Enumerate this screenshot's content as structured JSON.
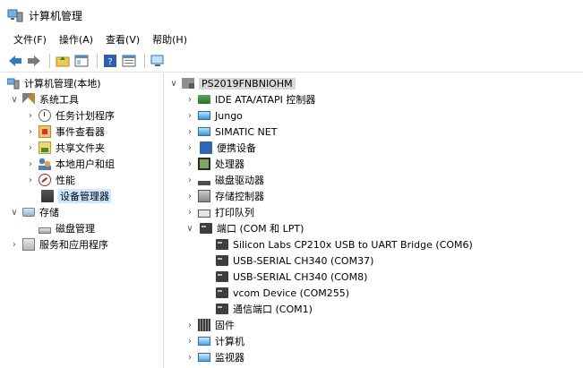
{
  "window": {
    "title": "计算机管理",
    "app_icon": "computer-management-icon"
  },
  "menu": [
    {
      "label": "文件(F)"
    },
    {
      "label": "操作(A)"
    },
    {
      "label": "查看(V)"
    },
    {
      "label": "帮助(H)"
    }
  ],
  "toolbar": {
    "buttons": [
      "back-icon",
      "forward-icon",
      "up-folder-icon",
      "show-hide-tree-icon",
      "help-icon",
      "properties-icon",
      "scan-hardware-icon"
    ]
  },
  "left_tree": {
    "root": "计算机管理(本地)",
    "system_tools": "系统工具",
    "task_scheduler": "任务计划程序",
    "event_viewer": "事件查看器",
    "shared_folders": "共享文件夹",
    "local_users": "本地用户和组",
    "performance": "性能",
    "device_manager": "设备管理器",
    "storage": "存储",
    "disk_management": "磁盘管理",
    "services_apps": "服务和应用程序"
  },
  "right_tree": {
    "computer_name": "PS2019FNBNIOHM",
    "categories": {
      "ide": "IDE ATA/ATAPI 控制器",
      "jungo": "Jungo",
      "simatic": "SIMATIC NET",
      "portable": "便携设备",
      "processor": "处理器",
      "disk_drives": "磁盘驱动器",
      "storage_ctl": "存储控制器",
      "print_queue": "打印队列",
      "ports": "端口 (COM 和 LPT)",
      "firmware": "固件",
      "computer": "计算机",
      "monitor": "监视器"
    },
    "ports": [
      "Silicon Labs CP210x USB to UART Bridge (COM6)",
      "USB-SERIAL CH340 (COM37)",
      "USB-SERIAL CH340 (COM8)",
      "vcom Device (COM255)",
      "通信端口 (COM1)"
    ]
  },
  "colors": {
    "selection": "#cce8ff",
    "root_selection": "#d9d9d9"
  }
}
